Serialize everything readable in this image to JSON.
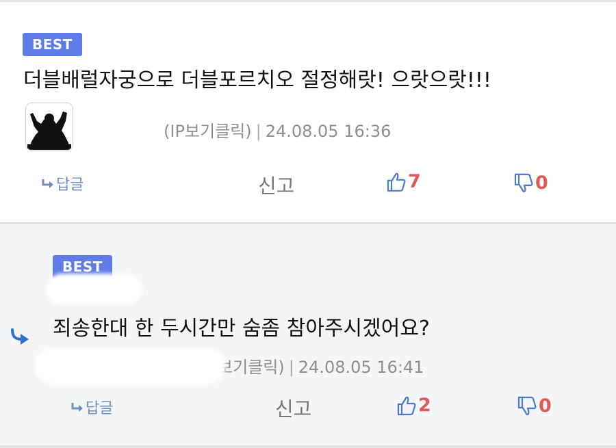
{
  "comments": [
    {
      "badge": "BEST",
      "text": "더블배럴자궁으로 더블포르치오 절정해랏! 으랏으랏!!!",
      "ip_link": "(IP보기클릭)",
      "separator": "|",
      "timestamp": "24.08.05 16:36",
      "reply_label": "답글",
      "report_label": "신고",
      "upvotes": "7",
      "downvotes": "0"
    },
    {
      "badge": "BEST",
      "text": "죄송한대 한 두시간만 숨좀 참아주시겠어요?",
      "ip_link": "보기클릭)",
      "separator": "|",
      "timestamp": "24.08.05 16:41",
      "reply_label": "답글",
      "report_label": "신고",
      "upvotes": "2",
      "downvotes": "0"
    }
  ],
  "colors": {
    "badge_bg": "#5f7be8",
    "vote_count": "#e05a55",
    "icon_blue": "#4a7cc9",
    "reply_link": "#6c8fc4"
  },
  "icons": [
    "user-avatar-icon",
    "reply-arrow-icon",
    "thumbs-up-icon",
    "thumbs-down-icon",
    "nested-reply-arrow-icon"
  ]
}
